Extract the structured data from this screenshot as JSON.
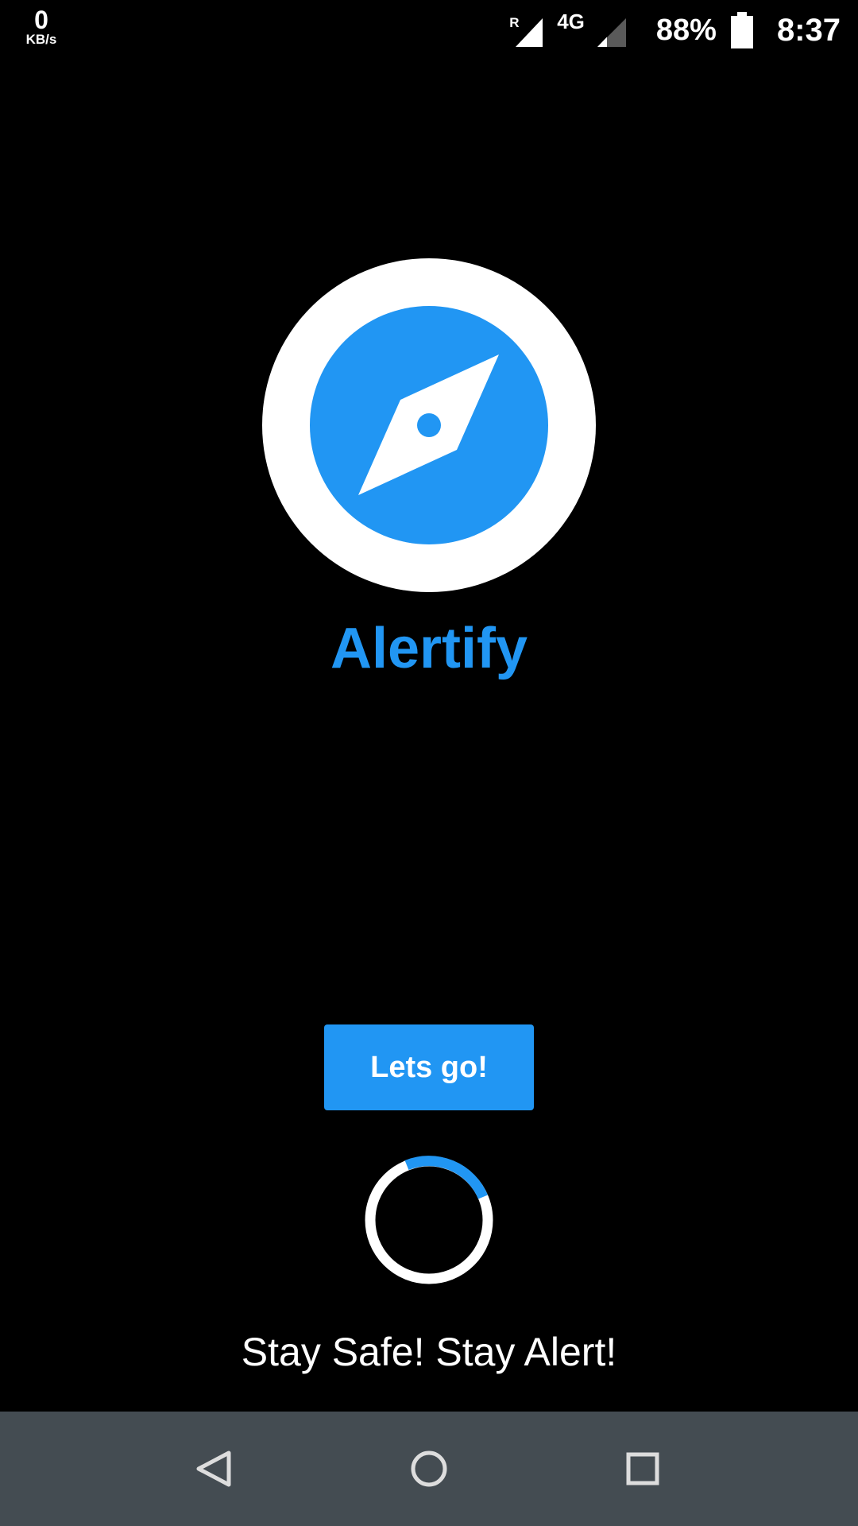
{
  "status_bar": {
    "net_speed_value": "0",
    "net_speed_unit": "KB/s",
    "roaming_tag": "R",
    "network_type": "4G",
    "battery_percent": "88%",
    "time": "8:37"
  },
  "app": {
    "logo_icon": "compass-icon",
    "title": "Alertify",
    "primary_button_label": "Lets go!",
    "tagline": "Stay Safe! Stay Alert!"
  },
  "navigation_bar": {
    "back_icon": "back-triangle-icon",
    "home_icon": "home-circle-icon",
    "recents_icon": "recents-square-icon"
  },
  "colors": {
    "background": "#000000",
    "accent": "#2196F3",
    "nav_bar": "#444C52",
    "text": "#FFFFFF"
  }
}
